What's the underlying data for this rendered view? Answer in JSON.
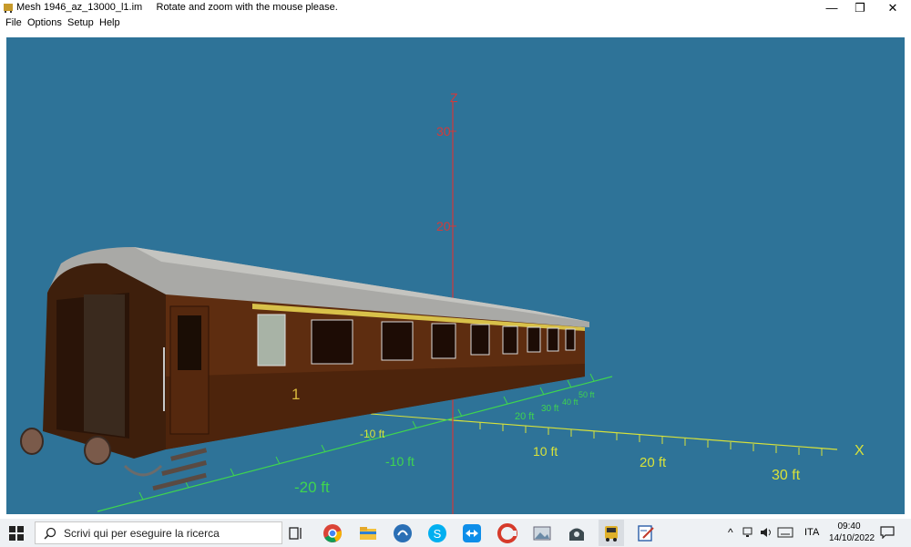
{
  "window": {
    "title": "Mesh 1946_az_13000_l1.im",
    "message": "Rotate and zoom with the mouse please.",
    "minimize_glyph": "—",
    "restore_glyph": "❐",
    "close_glyph": "✕"
  },
  "menu": {
    "items": [
      "File",
      "Options",
      "Setup",
      "Help"
    ]
  },
  "viewport": {
    "background": "#2e7398",
    "axis_labels": {
      "z": "Z",
      "x": "X"
    },
    "z_ticks": [
      "30",
      "20"
    ],
    "x_ticks": [
      "10 ft",
      "20 ft",
      "30 ft"
    ],
    "y_ticks": [
      "-20 ft",
      "-10 ft",
      "-10 ft",
      "20 ft",
      "30 ft",
      "40 ft",
      "50 ft"
    ],
    "car_number": "1"
  },
  "taskbar": {
    "search_placeholder": "Scrivi qui per eseguire la ricerca",
    "apps": [
      "task-view-icon",
      "chrome-icon",
      "file-explorer-icon",
      "app-blue-icon",
      "skype-icon",
      "teamviewer-icon",
      "ccleaner-icon",
      "photos-icon",
      "trainz-icon",
      "bus-icon",
      "editor-icon"
    ],
    "language": "ITA",
    "time": "09:40",
    "date": "14/10/2022"
  }
}
